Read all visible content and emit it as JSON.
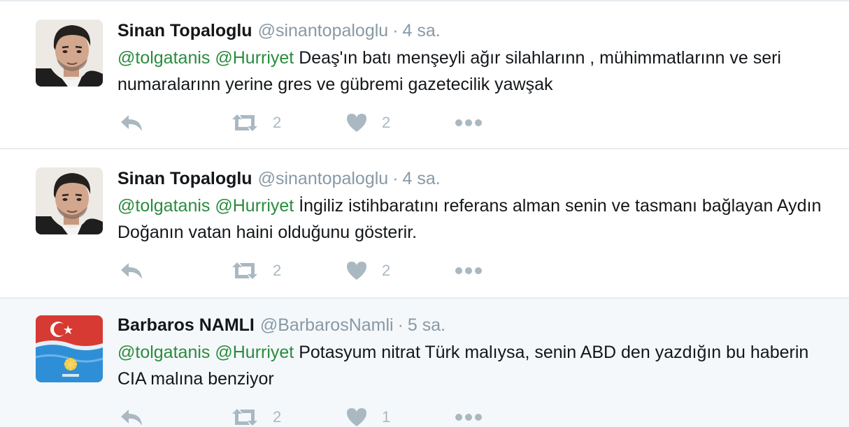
{
  "tweets": [
    {
      "name": "Sinan Topaloglu",
      "handle": "@sinantopaloglu",
      "separator": "·",
      "time": "4 sa.",
      "mention1": "@tolgatanis",
      "mention2": "@Hurriyet",
      "text": "Deaş'ın batı menşeyli ağır silahlarınn , mühimmatlarınn ve seri numaralarınn yerine gres ve gübremi gazetecilik yawşak",
      "retweets": "2",
      "likes": "2",
      "avatar_icon": "person-photo-icon"
    },
    {
      "name": "Sinan Topaloglu",
      "handle": "@sinantopaloglu",
      "separator": "·",
      "time": "4 sa.",
      "mention1": "@tolgatanis",
      "mention2": "@Hurriyet",
      "text": "İngiliz istihbaratını referans alman senin ve tasmanı bağlayan Aydın Doğanın vatan haini olduğunu gösterir.",
      "retweets": "2",
      "likes": "2",
      "avatar_icon": "person-photo-icon"
    },
    {
      "name": "Barbaros NAMLI",
      "handle": "@BarbarosNamli",
      "separator": "·",
      "time": "5 sa.",
      "mention1": "@tolgatanis",
      "mention2": "@Hurriyet",
      "text": "Potasyum nitrat Türk malıysa, senin ABD den yazdığın bu haberin CIA malına benziyor",
      "retweets": "2",
      "likes": "1",
      "avatar_icon": "flags-icon"
    }
  ],
  "colors": {
    "mention": "#2a8b3e",
    "meta": "#8899a6",
    "icon": "#aab8c2",
    "text": "#14171a",
    "highlight_bg": "#f5f8fa",
    "divider": "#e6ecf0"
  },
  "icons": {
    "reply": "reply-icon",
    "retweet": "retweet-icon",
    "like": "heart-icon",
    "more": "more-dots-icon"
  }
}
